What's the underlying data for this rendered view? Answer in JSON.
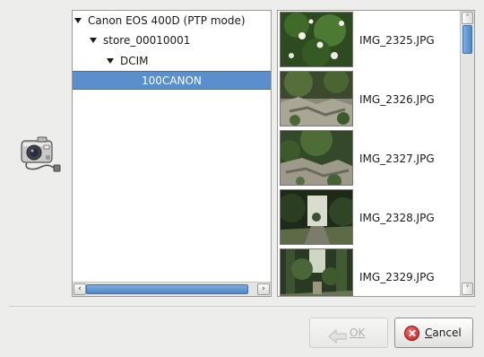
{
  "device_icon": "camera-icon",
  "tree": {
    "items": [
      {
        "label": "Canon EOS 400D (PTP mode)",
        "level": 0,
        "expanded": true,
        "selected": false
      },
      {
        "label": "store_00010001",
        "level": 1,
        "expanded": true,
        "selected": false
      },
      {
        "label": "DCIM",
        "level": 2,
        "expanded": true,
        "selected": false
      },
      {
        "label": "100CANON",
        "level": 3,
        "expanded": false,
        "selected": true
      }
    ],
    "selection_color": "#5a8fcb"
  },
  "images": [
    {
      "name": "IMG_2325.JPG"
    },
    {
      "name": "IMG_2326.JPG"
    },
    {
      "name": "IMG_2327.JPG"
    },
    {
      "name": "IMG_2328.JPG"
    },
    {
      "name": "IMG_2329.JPG"
    }
  ],
  "buttons": {
    "ok": {
      "label": "OK",
      "enabled": false,
      "icon": "arrow-left-icon"
    },
    "cancel": {
      "label_prefix": "C",
      "label_rest": "ancel",
      "enabled": true,
      "icon": "cancel-icon"
    }
  }
}
